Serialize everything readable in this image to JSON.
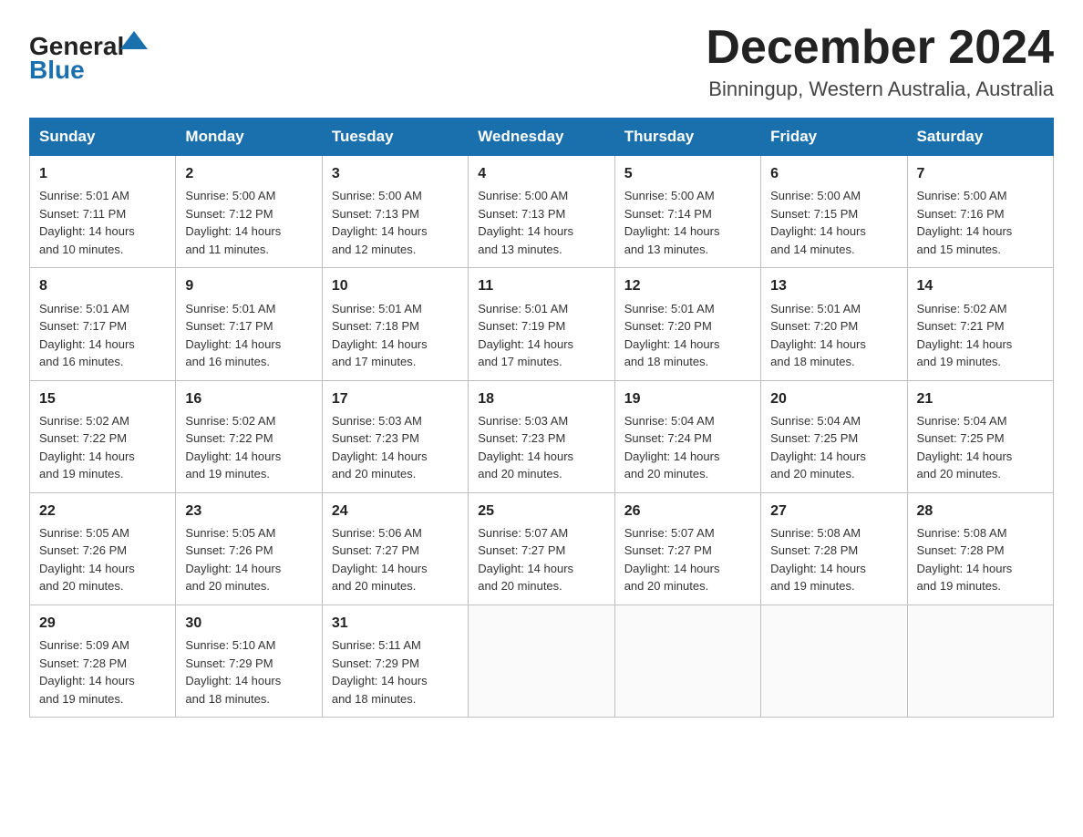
{
  "header": {
    "logo_general": "General",
    "logo_blue": "Blue",
    "month_title": "December 2024",
    "location": "Binningup, Western Australia, Australia"
  },
  "weekdays": [
    "Sunday",
    "Monday",
    "Tuesday",
    "Wednesday",
    "Thursday",
    "Friday",
    "Saturday"
  ],
  "weeks": [
    [
      {
        "day": "1",
        "sunrise": "5:01 AM",
        "sunset": "7:11 PM",
        "daylight": "14 hours and 10 minutes."
      },
      {
        "day": "2",
        "sunrise": "5:00 AM",
        "sunset": "7:12 PM",
        "daylight": "14 hours and 11 minutes."
      },
      {
        "day": "3",
        "sunrise": "5:00 AM",
        "sunset": "7:13 PM",
        "daylight": "14 hours and 12 minutes."
      },
      {
        "day": "4",
        "sunrise": "5:00 AM",
        "sunset": "7:13 PM",
        "daylight": "14 hours and 13 minutes."
      },
      {
        "day": "5",
        "sunrise": "5:00 AM",
        "sunset": "7:14 PM",
        "daylight": "14 hours and 13 minutes."
      },
      {
        "day": "6",
        "sunrise": "5:00 AM",
        "sunset": "7:15 PM",
        "daylight": "14 hours and 14 minutes."
      },
      {
        "day": "7",
        "sunrise": "5:00 AM",
        "sunset": "7:16 PM",
        "daylight": "14 hours and 15 minutes."
      }
    ],
    [
      {
        "day": "8",
        "sunrise": "5:01 AM",
        "sunset": "7:17 PM",
        "daylight": "14 hours and 16 minutes."
      },
      {
        "day": "9",
        "sunrise": "5:01 AM",
        "sunset": "7:17 PM",
        "daylight": "14 hours and 16 minutes."
      },
      {
        "day": "10",
        "sunrise": "5:01 AM",
        "sunset": "7:18 PM",
        "daylight": "14 hours and 17 minutes."
      },
      {
        "day": "11",
        "sunrise": "5:01 AM",
        "sunset": "7:19 PM",
        "daylight": "14 hours and 17 minutes."
      },
      {
        "day": "12",
        "sunrise": "5:01 AM",
        "sunset": "7:20 PM",
        "daylight": "14 hours and 18 minutes."
      },
      {
        "day": "13",
        "sunrise": "5:01 AM",
        "sunset": "7:20 PM",
        "daylight": "14 hours and 18 minutes."
      },
      {
        "day": "14",
        "sunrise": "5:02 AM",
        "sunset": "7:21 PM",
        "daylight": "14 hours and 19 minutes."
      }
    ],
    [
      {
        "day": "15",
        "sunrise": "5:02 AM",
        "sunset": "7:22 PM",
        "daylight": "14 hours and 19 minutes."
      },
      {
        "day": "16",
        "sunrise": "5:02 AM",
        "sunset": "7:22 PM",
        "daylight": "14 hours and 19 minutes."
      },
      {
        "day": "17",
        "sunrise": "5:03 AM",
        "sunset": "7:23 PM",
        "daylight": "14 hours and 20 minutes."
      },
      {
        "day": "18",
        "sunrise": "5:03 AM",
        "sunset": "7:23 PM",
        "daylight": "14 hours and 20 minutes."
      },
      {
        "day": "19",
        "sunrise": "5:04 AM",
        "sunset": "7:24 PM",
        "daylight": "14 hours and 20 minutes."
      },
      {
        "day": "20",
        "sunrise": "5:04 AM",
        "sunset": "7:25 PM",
        "daylight": "14 hours and 20 minutes."
      },
      {
        "day": "21",
        "sunrise": "5:04 AM",
        "sunset": "7:25 PM",
        "daylight": "14 hours and 20 minutes."
      }
    ],
    [
      {
        "day": "22",
        "sunrise": "5:05 AM",
        "sunset": "7:26 PM",
        "daylight": "14 hours and 20 minutes."
      },
      {
        "day": "23",
        "sunrise": "5:05 AM",
        "sunset": "7:26 PM",
        "daylight": "14 hours and 20 minutes."
      },
      {
        "day": "24",
        "sunrise": "5:06 AM",
        "sunset": "7:27 PM",
        "daylight": "14 hours and 20 minutes."
      },
      {
        "day": "25",
        "sunrise": "5:07 AM",
        "sunset": "7:27 PM",
        "daylight": "14 hours and 20 minutes."
      },
      {
        "day": "26",
        "sunrise": "5:07 AM",
        "sunset": "7:27 PM",
        "daylight": "14 hours and 20 minutes."
      },
      {
        "day": "27",
        "sunrise": "5:08 AM",
        "sunset": "7:28 PM",
        "daylight": "14 hours and 19 minutes."
      },
      {
        "day": "28",
        "sunrise": "5:08 AM",
        "sunset": "7:28 PM",
        "daylight": "14 hours and 19 minutes."
      }
    ],
    [
      {
        "day": "29",
        "sunrise": "5:09 AM",
        "sunset": "7:28 PM",
        "daylight": "14 hours and 19 minutes."
      },
      {
        "day": "30",
        "sunrise": "5:10 AM",
        "sunset": "7:29 PM",
        "daylight": "14 hours and 18 minutes."
      },
      {
        "day": "31",
        "sunrise": "5:11 AM",
        "sunset": "7:29 PM",
        "daylight": "14 hours and 18 minutes."
      },
      null,
      null,
      null,
      null
    ]
  ],
  "labels": {
    "sunrise": "Sunrise:",
    "sunset": "Sunset:",
    "daylight": "Daylight:"
  }
}
